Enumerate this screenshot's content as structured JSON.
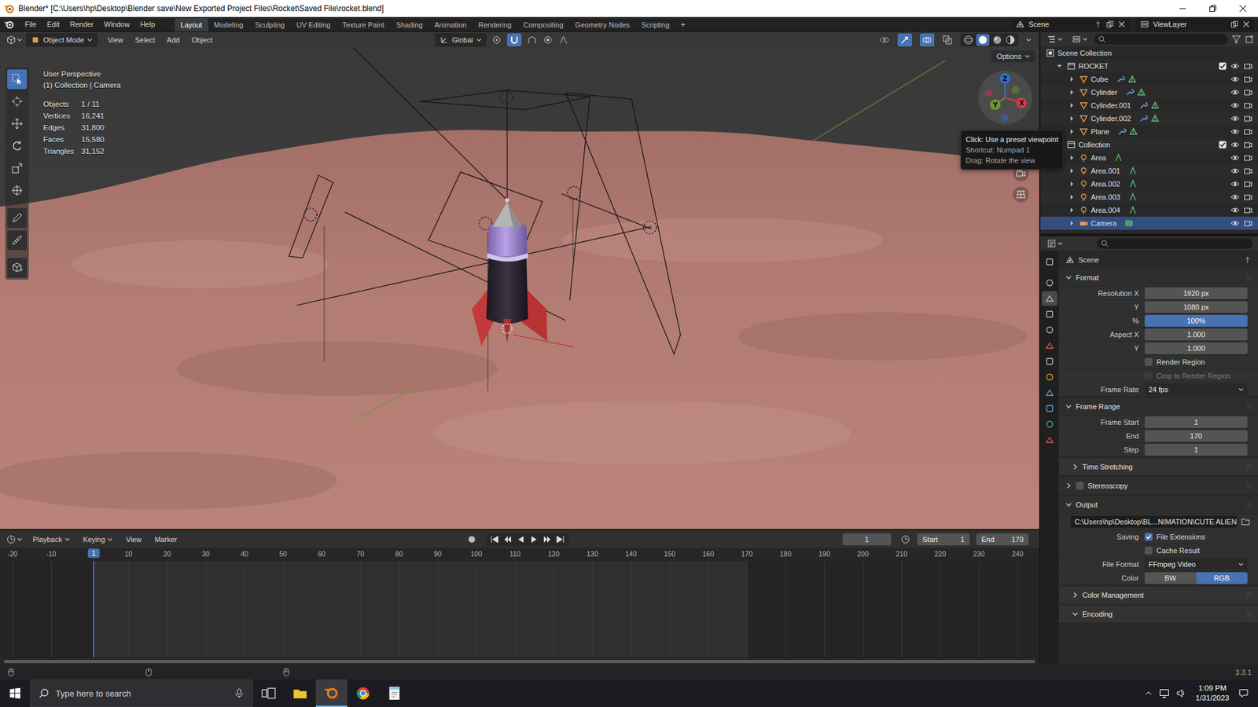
{
  "window": {
    "title": "Blender* [C:\\Users\\hp\\Desktop\\Blender save\\New Exported Project Files\\Rocket\\Saved File\\rocket.blend]"
  },
  "menu": [
    "File",
    "Edit",
    "Render",
    "Window",
    "Help"
  ],
  "workspaces": [
    {
      "label": "Layout",
      "selected": true
    },
    {
      "label": "Modeling",
      "selected": false
    },
    {
      "label": "Sculpting",
      "selected": false
    },
    {
      "label": "UV Editing",
      "selected": false
    },
    {
      "label": "Texture Paint",
      "selected": false
    },
    {
      "label": "Shading",
      "selected": false
    },
    {
      "label": "Animation",
      "selected": false
    },
    {
      "label": "Rendering",
      "selected": false
    },
    {
      "label": "Compositing",
      "selected": false
    },
    {
      "label": "Geometry Nodes",
      "selected": false
    },
    {
      "label": "Scripting",
      "selected": false
    }
  ],
  "add_workspace": "+",
  "scene": "Scene",
  "view_layer": "ViewLayer",
  "viewport": {
    "mode": "Object Mode",
    "menus": [
      "View",
      "Select",
      "Add",
      "Object"
    ],
    "orientation": "Global",
    "options": "Options",
    "view_name": "User Perspective",
    "context": "(1) Collection | Camera",
    "stats": [
      {
        "label": "Objects",
        "value": "1 / 11"
      },
      {
        "label": "Vertices",
        "value": "16,241"
      },
      {
        "label": "Edges",
        "value": "31,800"
      },
      {
        "label": "Faces",
        "value": "15,580"
      },
      {
        "label": "Triangles",
        "value": "31,152"
      }
    ],
    "tools": [
      {
        "selected": true
      },
      {
        "selected": false
      },
      {
        "selected": false
      },
      {
        "selected": false
      },
      {
        "selected": false
      },
      {
        "selected": false
      },
      {
        "selected": false
      },
      {
        "selected": false
      },
      {
        "selected": false
      }
    ],
    "gizmo": [
      {
        "label": "Z",
        "color": "#2f6ed8"
      },
      {
        "label": "Y",
        "color": "#6a9c2a"
      },
      {
        "label": "X",
        "color": "#d5384b"
      }
    ],
    "tooltip": [
      "Click: Use a preset viewpoint",
      "Shortcut: Numpad 1",
      "Drag: Rotate the view"
    ]
  },
  "outliner": {
    "root": "Scene Collection",
    "items": [
      {
        "name": "ROCKET",
        "kind": "collection",
        "depth": 0,
        "expanded": true,
        "visible": true,
        "checked": true,
        "selected": false
      },
      {
        "name": "Cube",
        "kind": "mesh",
        "depth": 1,
        "expanded": false,
        "visible": true,
        "selected": false
      },
      {
        "name": "Cylinder",
        "kind": "mesh",
        "depth": 1,
        "expanded": false,
        "visible": true,
        "selected": false
      },
      {
        "name": "Cylinder.001",
        "kind": "mesh",
        "depth": 1,
        "expanded": false,
        "visible": true,
        "selected": false
      },
      {
        "name": "Cylinder.002",
        "kind": "mesh",
        "depth": 1,
        "expanded": false,
        "visible": true,
        "selected": false
      },
      {
        "name": "Plane",
        "kind": "mesh",
        "depth": 1,
        "expanded": false,
        "visible": true,
        "selected": false
      },
      {
        "name": "Collection",
        "kind": "collection",
        "depth": 0,
        "expanded": true,
        "visible": true,
        "checked": true,
        "selected": false
      },
      {
        "name": "Area",
        "kind": "light",
        "depth": 1,
        "expanded": false,
        "visible": true,
        "selected": false
      },
      {
        "name": "Area.001",
        "kind": "light",
        "depth": 1,
        "expanded": false,
        "visible": true,
        "selected": false
      },
      {
        "name": "Area.002",
        "kind": "light",
        "depth": 1,
        "expanded": false,
        "visible": true,
        "selected": false
      },
      {
        "name": "Area.003",
        "kind": "light",
        "depth": 1,
        "expanded": false,
        "visible": true,
        "selected": false
      },
      {
        "name": "Area.004",
        "kind": "light",
        "depth": 1,
        "expanded": false,
        "visible": true,
        "selected": false
      },
      {
        "name": "Camera",
        "kind": "camera",
        "depth": 1,
        "expanded": false,
        "visible": true,
        "selected": true
      }
    ]
  },
  "properties": {
    "context": "Scene",
    "tabs": [
      {
        "color": "#b5b5b5",
        "selected": false
      },
      {
        "color": "#b5b5b5",
        "selected": false
      },
      {
        "color": "#b5b5b5",
        "selected": true
      },
      {
        "color": "#b5b5b5",
        "selected": false
      },
      {
        "color": "#b5b5b5",
        "selected": false
      },
      {
        "color": "#d45757",
        "selected": false
      },
      {
        "color": "#b5b5b5",
        "selected": false
      },
      {
        "color": "#e39a3b",
        "selected": false
      },
      {
        "color": "#5fa3d8",
        "selected": false
      },
      {
        "color": "#5fa3d8",
        "selected": false
      },
      {
        "color": "#49b06c",
        "selected": false
      },
      {
        "color": "#d45757",
        "selected": false
      }
    ],
    "rows": [
      {
        "kind": "section",
        "label": "Format",
        "expanded": true
      },
      {
        "kind": "field",
        "label": "Resolution X",
        "value": "1920 px"
      },
      {
        "kind": "field",
        "label": "Y",
        "value": "1080 px"
      },
      {
        "kind": "slider",
        "label": "%",
        "value": "100%",
        "level": 1
      },
      {
        "kind": "field",
        "label": "Aspect X",
        "value": "1.000"
      },
      {
        "kind": "field",
        "label": "Y",
        "value": "1.000"
      },
      {
        "kind": "checkbox",
        "label": "",
        "text": "Render Region",
        "checked": false,
        "disabled": false
      },
      {
        "kind": "checkbox",
        "label": "",
        "text": "Crop to Render Region",
        "checked": false,
        "disabled": true
      },
      {
        "kind": "dropdown",
        "label": "Frame Rate",
        "value": "24 fps"
      },
      {
        "kind": "section",
        "label": "Frame Range",
        "expanded": true
      },
      {
        "kind": "field",
        "label": "Frame Start",
        "value": "1"
      },
      {
        "kind": "field",
        "label": "End",
        "value": "170"
      },
      {
        "kind": "field",
        "label": "Step",
        "value": "1"
      },
      {
        "kind": "subsection",
        "label": "Time Stretching",
        "expanded": false
      },
      {
        "kind": "section-check",
        "label": "Stereoscopy",
        "expanded": false,
        "checked": false
      },
      {
        "kind": "section",
        "label": "Output",
        "expanded": true
      },
      {
        "kind": "path",
        "value": "C:\\Users\\hp\\Desktop\\BL...NIMATION\\CUTE ALIEN"
      },
      {
        "kind": "checkbox",
        "label": "Saving",
        "text": "File Extensions",
        "checked": true,
        "disabled": false
      },
      {
        "kind": "checkbox",
        "label": "",
        "text": "Cache Result",
        "checked": false,
        "disabled": false
      },
      {
        "kind": "dropdown",
        "label": "File Format",
        "value": "FFmpeg Video"
      },
      {
        "kind": "toggle",
        "label": "Color",
        "options": [
          {
            "label": "BW",
            "selected": false
          },
          {
            "label": "RGB",
            "selected": true
          }
        ]
      },
      {
        "kind": "subsection",
        "label": "Color Management",
        "expanded": false
      },
      {
        "kind": "subsection",
        "label": "Encoding",
        "expanded": true
      }
    ]
  },
  "timeline": {
    "menus": [
      {
        "label": "Playback",
        "dropdown": true
      },
      {
        "label": "Keying",
        "dropdown": true
      },
      {
        "label": "View",
        "dropdown": false
      },
      {
        "label": "Marker",
        "dropdown": false
      }
    ],
    "current_frame": "1",
    "start_label": "Start",
    "start": "1",
    "end_label": "End",
    "end": "170",
    "ruler": [
      {
        "label": "-20",
        "selected": false
      },
      {
        "label": "-10",
        "selected": false
      },
      {
        "label": "1",
        "selected": true
      },
      {
        "label": "10",
        "selected": false
      },
      {
        "label": "20",
        "selected": false
      },
      {
        "label": "30",
        "selected": false
      },
      {
        "label": "40",
        "selected": false
      },
      {
        "label": "50",
        "selected": false
      },
      {
        "label": "60",
        "selected": false
      },
      {
        "label": "70",
        "selected": false
      },
      {
        "label": "80",
        "selected": false
      },
      {
        "label": "90",
        "selected": false
      },
      {
        "label": "100",
        "selected": false
      },
      {
        "label": "110",
        "selected": false
      },
      {
        "label": "120",
        "selected": false
      },
      {
        "label": "130",
        "selected": false
      },
      {
        "label": "140",
        "selected": false
      },
      {
        "label": "150",
        "selected": false
      },
      {
        "label": "160",
        "selected": false
      },
      {
        "label": "170",
        "selected": false
      },
      {
        "label": "180",
        "selected": false
      },
      {
        "label": "190",
        "selected": false
      },
      {
        "label": "200",
        "selected": false
      },
      {
        "label": "210",
        "selected": false
      },
      {
        "label": "220",
        "selected": false
      },
      {
        "label": "230",
        "selected": false
      },
      {
        "label": "240",
        "selected": false
      }
    ]
  },
  "status_bar": {
    "version": "3.3.1"
  },
  "taskbar": {
    "search_placeholder": "Type here to search",
    "apps": [
      {
        "color": "#f0c330",
        "selected": false
      },
      {
        "color": "#e87d0d",
        "selected": true
      },
      {
        "color": "#4285f4",
        "selected": false
      },
      {
        "color": "#8ecae6",
        "selected": false
      }
    ],
    "time": "1:09 PM",
    "date": "1/31/2023"
  }
}
